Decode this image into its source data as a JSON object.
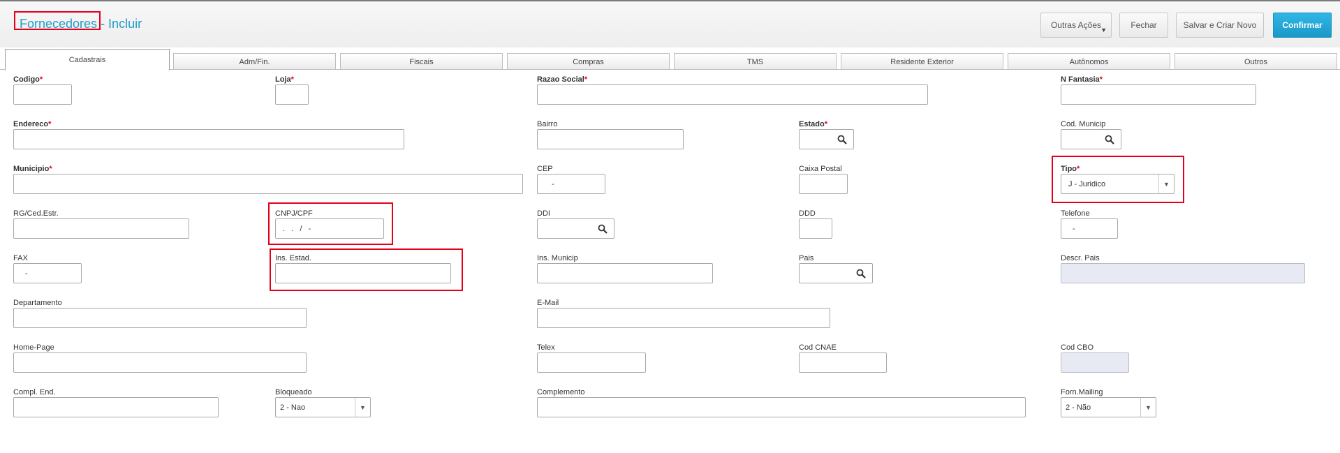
{
  "header": {
    "title_main": "Fornecedores",
    "title_suffix": " - Incluir"
  },
  "toolbar": {
    "more_actions": "Outras Ações",
    "close": "Fechar",
    "save_new": "Salvar e Criar Novo",
    "confirm": "Confirmar"
  },
  "tabs": [
    "Cadastrais",
    "Adm/Fin.",
    "Fiscais",
    "Compras",
    "TMS",
    "Residente Exterior",
    "Autônomos",
    "Outros"
  ],
  "fields": {
    "codigo": {
      "label": "Codigo",
      "value": ""
    },
    "loja": {
      "label": "Loja",
      "value": ""
    },
    "razao_social": {
      "label": "Razao Social",
      "value": ""
    },
    "n_fantasia": {
      "label": "N Fantasia",
      "value": ""
    },
    "endereco": {
      "label": "Endereco",
      "value": ""
    },
    "bairro": {
      "label": "Bairro",
      "value": ""
    },
    "estado": {
      "label": "Estado",
      "value": ""
    },
    "cod_municip": {
      "label": "Cod. Municip",
      "value": ""
    },
    "municipio": {
      "label": "Municipio",
      "value": ""
    },
    "cep": {
      "label": "CEP",
      "value": "-"
    },
    "caixa_postal": {
      "label": "Caixa Postal",
      "value": ""
    },
    "tipo": {
      "label": "Tipo",
      "value": "J - Juridico"
    },
    "rg_ced_estr": {
      "label": "RG/Ced.Estr.",
      "value": ""
    },
    "cnpj_cpf": {
      "label": "CNPJ/CPF",
      "value": ".   .   /   -"
    },
    "ddi": {
      "label": "DDI",
      "value": ""
    },
    "ddd": {
      "label": "DDD",
      "value": ""
    },
    "telefone": {
      "label": "Telefone",
      "value": "-"
    },
    "fax": {
      "label": "FAX",
      "value": "-"
    },
    "ins_estad": {
      "label": "Ins. Estad.",
      "value": ""
    },
    "ins_municip": {
      "label": "Ins. Municip",
      "value": ""
    },
    "pais": {
      "label": "Pais",
      "value": ""
    },
    "descr_pais": {
      "label": "Descr. Pais",
      "value": ""
    },
    "departamento": {
      "label": "Departamento",
      "value": ""
    },
    "email": {
      "label": "E-Mail",
      "value": ""
    },
    "home_page": {
      "label": "Home-Page",
      "value": ""
    },
    "telex": {
      "label": "Telex",
      "value": ""
    },
    "cod_cnae": {
      "label": "Cod CNAE",
      "value": ""
    },
    "cod_cbo": {
      "label": "Cod CBO",
      "value": ""
    },
    "compl_end": {
      "label": "Compl. End.",
      "value": ""
    },
    "bloqueado": {
      "label": "Bloqueado",
      "value": "2 - Nao"
    },
    "complemento": {
      "label": "Complemento",
      "value": ""
    },
    "forn_mailing": {
      "label": "Forn.Mailing",
      "value": "2 - Não"
    }
  },
  "icons": {
    "lookup": "magnifier-icon",
    "dropdown": "chevron-down-icon"
  },
  "colors": {
    "title": "#1f9cc8",
    "confirm": "#1a98c8",
    "required": "#e3001b",
    "highlight": "#e3001b"
  }
}
